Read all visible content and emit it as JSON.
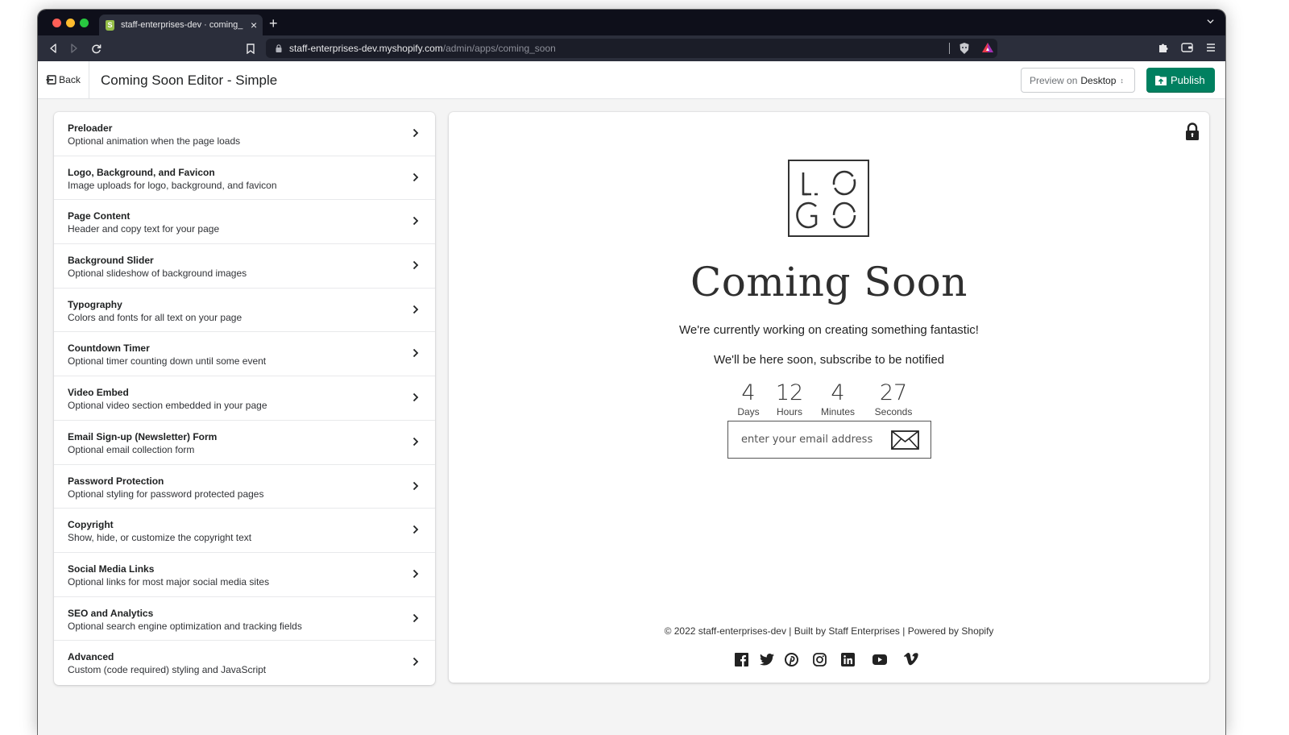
{
  "browser": {
    "tab_title": "staff-enterprises-dev · coming_",
    "tab_favicon": "shopify-icon",
    "url_host": "staff-enterprises-dev.myshopify.com",
    "url_path": "/admin/apps/coming_soon"
  },
  "header": {
    "back_label": "Back",
    "title": "Coming Soon Editor - Simple",
    "preview_prefix": "Preview on",
    "preview_value": "Desktop",
    "publish_label": "Publish",
    "accent_color": "#008060"
  },
  "sidebar": {
    "items": [
      {
        "title": "Preloader",
        "desc": "Optional animation when the page loads"
      },
      {
        "title": "Logo, Background, and Favicon",
        "desc": "Image uploads for logo, background, and favicon"
      },
      {
        "title": "Page Content",
        "desc": "Header and copy text for your page"
      },
      {
        "title": "Background Slider",
        "desc": "Optional slideshow of background images"
      },
      {
        "title": "Typography",
        "desc": "Colors and fonts for all text on your page"
      },
      {
        "title": "Countdown Timer",
        "desc": "Optional timer counting down until some event"
      },
      {
        "title": "Video Embed",
        "desc": "Optional video section embedded in your page"
      },
      {
        "title": "Email Sign-up (Newsletter) Form",
        "desc": "Optional email collection form"
      },
      {
        "title": "Password Protection",
        "desc": "Optional styling for password protected pages"
      },
      {
        "title": "Copyright",
        "desc": "Show, hide, or customize the copyright text"
      },
      {
        "title": "Social Media Links",
        "desc": "Optional links for most major social media sites"
      },
      {
        "title": "SEO and Analytics",
        "desc": "Optional search engine optimization and tracking fields"
      },
      {
        "title": "Advanced",
        "desc": "Custom (code required) styling and JavaScript"
      }
    ]
  },
  "preview": {
    "logo_text": "LOGO",
    "title": "Coming Soon",
    "line1": "We're currently working on creating something fantastic!",
    "line2": "We'll be here soon, subscribe to be notified",
    "countdown": [
      {
        "value": "4",
        "label": "Days"
      },
      {
        "value": "12",
        "label": "Hours"
      },
      {
        "value": "4",
        "label": "Minutes"
      },
      {
        "value": "27",
        "label": "Seconds"
      }
    ],
    "email_placeholder": "enter your email address",
    "copyright": "© 2022 staff-enterprises-dev | Built by Staff Enterprises | Powered by Shopify",
    "socials": [
      "facebook-icon",
      "twitter-icon",
      "pinterest-icon",
      "instagram-icon",
      "linkedin-icon",
      "youtube-icon",
      "vimeo-icon"
    ]
  }
}
